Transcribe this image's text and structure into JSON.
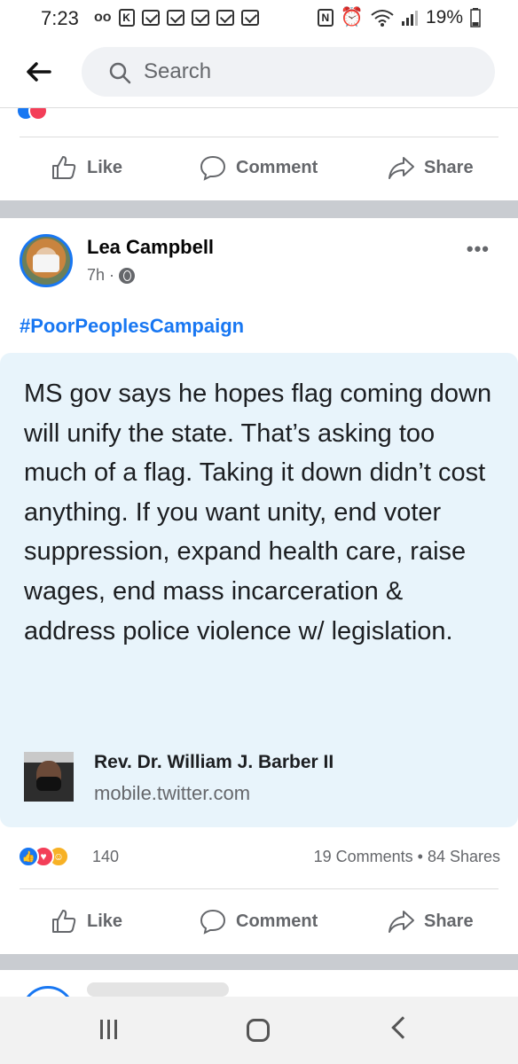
{
  "status_bar": {
    "time": "7:23",
    "voicemail": "oo",
    "battery": "19%"
  },
  "header": {
    "search_placeholder": "Search"
  },
  "actions": {
    "like": "Like",
    "comment": "Comment",
    "share": "Share"
  },
  "post": {
    "author": "Lea Campbell",
    "time": "7h",
    "hashtag": "#PoorPeoplesCampaign",
    "link_card": {
      "text": "MS gov says he hopes flag coming down will unify the state. That’s asking too much of a flag. Taking it down didn’t cost anything. If you want unity, end voter suppression, expand health care, raise wages, end mass incarceration & address police violence w/ legislation.",
      "author": "Rev. Dr. William J. Barber II",
      "domain": "mobile.twitter.com"
    },
    "reaction_count": "140",
    "comments_shares": "19 Comments • 84 Shares"
  },
  "colors": {
    "accent": "#1877f2",
    "card_bg": "#e8f4fb",
    "separator": "#c9ccd1",
    "muted": "#65676b"
  }
}
